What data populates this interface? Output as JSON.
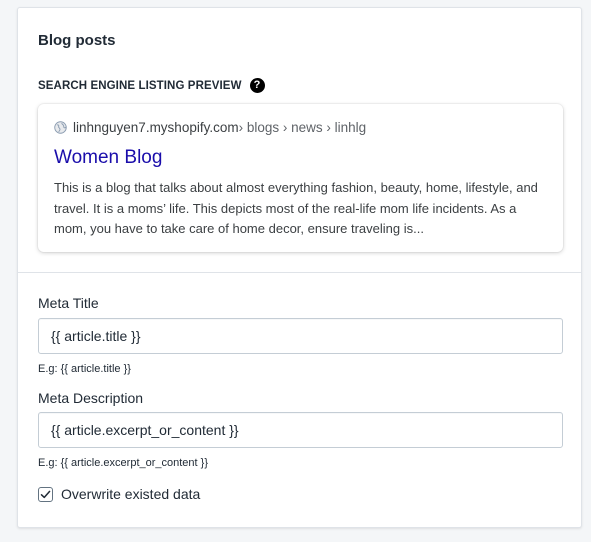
{
  "card": {
    "title": "Blog posts"
  },
  "seo_preview": {
    "heading": "SEARCH ENGINE LISTING PREVIEW",
    "help_icon": "question-circle",
    "url": {
      "domain": "linhnguyen7.myshopify.com",
      "path": " › blogs › news › linhlg"
    },
    "title": "Women Blog",
    "description": "This is a blog that talks about almost everything fashion, beauty, home, lifestyle, and travel. It is a moms’ life. This depicts most of the real-life mom life incidents. As a mom, you have to take care of home decor, ensure traveling is..."
  },
  "meta_title": {
    "label": "Meta Title",
    "value": "{{ article.title }}",
    "hint": "E.g: {{ article.title }}"
  },
  "meta_description": {
    "label": "Meta Description",
    "value": "{{ article.excerpt_or_content }}",
    "hint": "E.g: {{ article.excerpt_or_content }}"
  },
  "overwrite": {
    "label": "Overwrite existed data",
    "checked": true
  },
  "colors": {
    "link_title": "#1a0dab",
    "border": "#c4cdd5",
    "background": "#f4f6f8"
  }
}
